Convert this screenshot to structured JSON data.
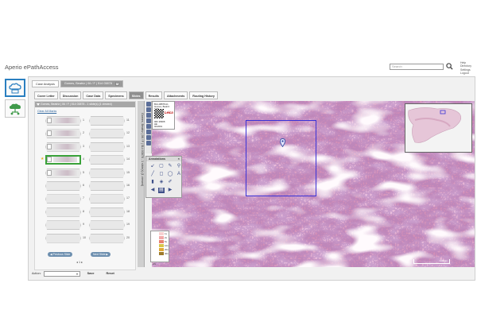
{
  "app": {
    "title": "Aperio ePathAccess",
    "search_placeholder": "Search",
    "links": [
      "Help",
      "Directory",
      "Settings",
      "Logout"
    ]
  },
  "case_tabs": {
    "case_analysis": "Case Analysis",
    "patient_tab": "Gomes, Beatriz | 06 / F | 514 03878"
  },
  "sub_tabs": [
    "Cover Letter",
    "Discussion",
    "Case Data",
    "Specimens",
    "Slides",
    "Results",
    "Attachments",
    "Routing History"
  ],
  "active_sub_tab": "Slides",
  "slides_panel": {
    "header": "Gomes, Beatriz | 06 / F | 514 03878 - 1 slide(s) (1 viewed)",
    "clear_all": "Clear All Marks",
    "left_numbers": [
      "1",
      "2",
      "3",
      "4",
      "5",
      "6",
      "7",
      "8",
      "9",
      "10"
    ],
    "right_numbers": [
      "11",
      "12",
      "13",
      "14",
      "15",
      "16",
      "17",
      "18",
      "19",
      "20"
    ],
    "prev_label": "Previous Slide",
    "next_label": "Next Slide",
    "page": "1"
  },
  "viewer": {
    "vertical_label": "Gomes, Beatriz | 06 / F | 514 03878 - 1 slide(s) (1 viewed)",
    "label_text": "B14-08878 A1\nGomes, Beatriz\nF 06\nLeica",
    "label_logo": "Leica",
    "label_id": "06F 28908\nHE\n02/2019",
    "annotations_title": "Annotations",
    "zoom_label": "20x",
    "legend": [
      {
        "label": "1x",
        "color": "#f7d0d0"
      },
      {
        "label": "2x",
        "color": "#f2a8a8"
      },
      {
        "label": "5x",
        "color": "#e7806f"
      },
      {
        "label": "10x",
        "color": "#d8c548"
      },
      {
        "label": "20x",
        "color": "#e0a833"
      },
      {
        "label": "40x",
        "color": "#9c7a2a"
      }
    ],
    "scale": "100 µm",
    "accent_roi": "#3b32d6",
    "accent_pin": "#3a53a6"
  },
  "footer": {
    "action_label": "Action:",
    "save": "Save",
    "reset": "Reset"
  }
}
